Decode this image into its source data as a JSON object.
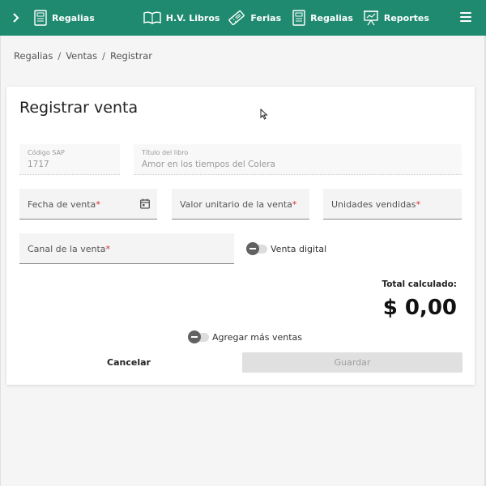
{
  "topbar": {
    "nav_items": [
      {
        "label": "Regalias"
      },
      {
        "label": "H.V. Libros"
      },
      {
        "label": "Ferias"
      },
      {
        "label": "Regalias"
      },
      {
        "label": "Reportes"
      }
    ],
    "color": "#1f8a70"
  },
  "breadcrumb": {
    "items": [
      "Regalias",
      "Ventas",
      "Registrar"
    ],
    "separator": "/"
  },
  "form": {
    "title": "Registrar venta",
    "codigo_sap": {
      "label": "Código SAP",
      "value": "1717"
    },
    "titulo_libro": {
      "label": "Título del libro",
      "value": "Amor en los tiempos del Colera"
    },
    "fecha_venta": {
      "placeholder": "Fecha de venta"
    },
    "valor_unitario": {
      "placeholder": "Valor unitario de la venta"
    },
    "unidades_vendidas": {
      "placeholder": "Unidades vendidas"
    },
    "canal_venta": {
      "placeholder": "Canal de la venta"
    },
    "required_mark": "*",
    "venta_digital_label": "Venta digital",
    "total_label": "Total calculado:",
    "total_value": "$ 0,00",
    "agregar_mas_label": "Agregar más ventas",
    "cancel_label": "Cancelar",
    "save_label": "Guardar"
  }
}
